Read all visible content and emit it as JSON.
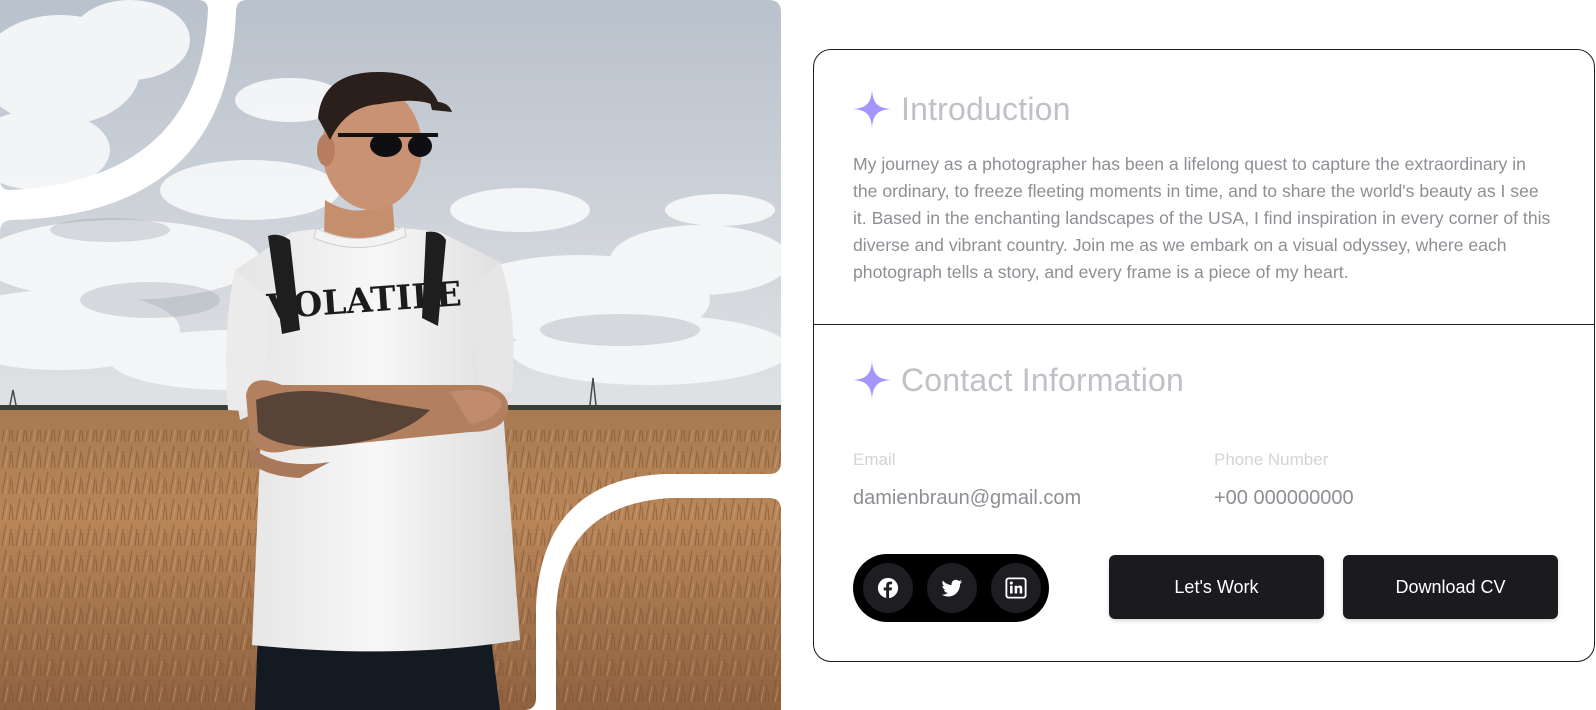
{
  "intro": {
    "title": "Introduction",
    "text": "My journey as a photographer has been a lifelong quest to capture the extraordinary in the ordinary, to freeze fleeting moments in time, and to share the world's beauty as I see it. Based in the enchanting landscapes of the USA, I find inspiration in every corner of this diverse and vibrant country. Join me as we embark on a visual odyssey, where each photograph tells a story, and every frame is a piece of my heart."
  },
  "contact": {
    "title": "Contact Information",
    "email_label": "Email",
    "email_value": "damienbraun@gmail.com",
    "phone_label": "Phone Number",
    "phone_value": "+00 000000000"
  },
  "socials": [
    {
      "icon": "facebook-icon"
    },
    {
      "icon": "twitter-icon"
    },
    {
      "icon": "linkedin-icon"
    }
  ],
  "buttons": {
    "work_label": "Let's Work",
    "cv_label": "Download CV"
  },
  "shirt_print": "VOLATILE",
  "colors": {
    "accent": "#a594f9",
    "card_border": "#1b1b1f",
    "button_bg": "#1b1b1f",
    "heading_text": "#c0c0c6",
    "body_text": "#8e8e94"
  }
}
